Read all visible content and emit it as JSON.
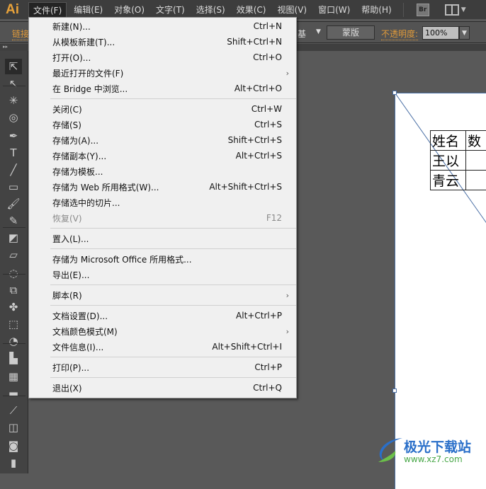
{
  "app": {
    "logo": "Ai"
  },
  "menubar": [
    "文件(F)",
    "编辑(E)",
    "对象(O)",
    "文字(T)",
    "选择(S)",
    "效果(C)",
    "视图(V)",
    "窗口(W)",
    "帮助(H)"
  ],
  "bridge_label": "Br",
  "control": {
    "link_label": "链接",
    "brush_value": "基",
    "mask_label": "蒙版",
    "opacity_label": "不透明度:",
    "opacity_value": "100%"
  },
  "file_menu": [
    [
      {
        "label": "新建(N)...",
        "shortcut": "Ctrl+N"
      },
      {
        "label": "从模板新建(T)...",
        "shortcut": "Shift+Ctrl+N"
      },
      {
        "label": "打开(O)...",
        "shortcut": "Ctrl+O"
      },
      {
        "label": "最近打开的文件(F)",
        "submenu": true
      },
      {
        "label": "在 Bridge 中浏览...",
        "shortcut": "Alt+Ctrl+O"
      }
    ],
    [
      {
        "label": "关闭(C)",
        "shortcut": "Ctrl+W"
      },
      {
        "label": "存储(S)",
        "shortcut": "Ctrl+S"
      },
      {
        "label": "存储为(A)...",
        "shortcut": "Shift+Ctrl+S"
      },
      {
        "label": "存储副本(Y)...",
        "shortcut": "Alt+Ctrl+S"
      },
      {
        "label": "存储为模板..."
      },
      {
        "label": "存储为 Web 所用格式(W)...",
        "shortcut": "Alt+Shift+Ctrl+S"
      },
      {
        "label": "存储选中的切片..."
      },
      {
        "label": "恢复(V)",
        "shortcut": "F12",
        "disabled": true
      }
    ],
    [
      {
        "label": "置入(L)..."
      }
    ],
    [
      {
        "label": "存储为 Microsoft Office 所用格式..."
      },
      {
        "label": "导出(E)..."
      }
    ],
    [
      {
        "label": "脚本(R)",
        "submenu": true
      }
    ],
    [
      {
        "label": "文档设置(D)...",
        "shortcut": "Alt+Ctrl+P"
      },
      {
        "label": "文档颜色模式(M)",
        "submenu": true
      },
      {
        "label": "文件信息(I)...",
        "shortcut": "Alt+Shift+Ctrl+I"
      }
    ],
    [
      {
        "label": "打印(P)...",
        "shortcut": "Ctrl+P"
      }
    ],
    [
      {
        "label": "退出(X)",
        "shortcut": "Ctrl+Q"
      }
    ]
  ],
  "artboard_table": [
    [
      "姓名",
      "数"
    ],
    [
      "王以",
      ""
    ],
    [
      "青云",
      ""
    ]
  ],
  "watermark": {
    "name": "极光下载站",
    "url": "www.xz7.com"
  },
  "colors": {
    "accent": "#e09a3a",
    "selection": "#4a6fa5"
  }
}
